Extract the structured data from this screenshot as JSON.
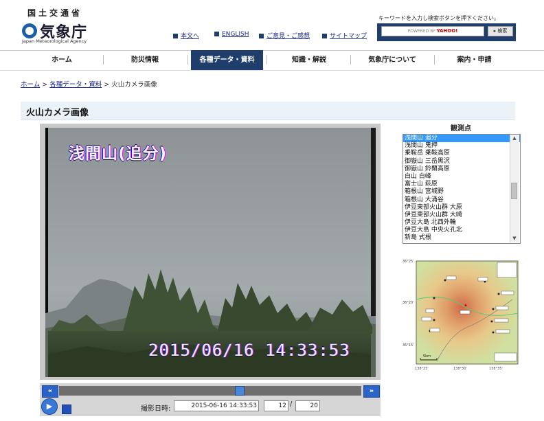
{
  "header": {
    "ministry": "国土交通省",
    "agency_name": "気象庁",
    "agency_en": "Japan Meteorological Agency",
    "links": [
      {
        "label": "本文へ"
      },
      {
        "label": "ENGLISH"
      },
      {
        "label": "ご意見・ご感想"
      },
      {
        "label": "サイトマップ"
      }
    ],
    "search": {
      "hint": "キーワードを入力し検索ボタンを押下ください。",
      "powered_by": "POWERED BY",
      "engine": "YAHOO!",
      "button": "検索"
    }
  },
  "nav": {
    "items": [
      {
        "label": "ホーム"
      },
      {
        "label": "防災情報"
      },
      {
        "label": "各種データ・資料"
      },
      {
        "label": "知識・解説"
      },
      {
        "label": "気象庁について"
      },
      {
        "label": "案内・申請"
      }
    ],
    "active_index": 2
  },
  "breadcrumb": {
    "home": "ホーム",
    "sep": " > ",
    "data": "各種データ・資料",
    "current": "火山カメラ画像"
  },
  "page_title": "火山カメラ画像",
  "camera": {
    "station_label": "浅間山(追分)",
    "timestamp_overlay": "2015/06/16 14:33:53"
  },
  "controls": {
    "prev_icon": "double-left-arrow-icon",
    "next_icon": "double-right-arrow-icon",
    "play_icon": "play-icon",
    "stop_icon": "stop-icon",
    "date_label": "撮影日時:",
    "datetime_value": "2015-06-16 14:33:53",
    "frame_current": "12",
    "frame_separator": "/",
    "frame_total": "20",
    "slider_position": 0.6
  },
  "observation": {
    "title": "観測点",
    "items": [
      "浅間山 追分",
      "浅間山 鬼押",
      "乗鞍岳 乗鞍高原",
      "御嶽山 三岳黒沢",
      "御嶽山 鈴蘭高原",
      "白山 白峰",
      "富士山 萩原",
      "箱根山 宮城野",
      "箱根山 大涌谷",
      "伊豆東部火山群 大原",
      "伊豆東部火山群 大崎",
      "伊豆大島 北西外輪",
      "伊豆大島 中央火孔北",
      "新島 式根"
    ],
    "selected_index": 0
  },
  "map": {
    "scale_label": "5km",
    "lat_ticks": [
      "36°25'",
      "36°20'",
      "36°15'"
    ],
    "lon_ticks": [
      "138°25'",
      "138°30'",
      "138°35'"
    ]
  },
  "colors": {
    "nav_active": "#1f3e6b",
    "list_selection": "#3399ff",
    "control_blue": "#2a64c8",
    "title_bar": "#eaf2f8"
  }
}
